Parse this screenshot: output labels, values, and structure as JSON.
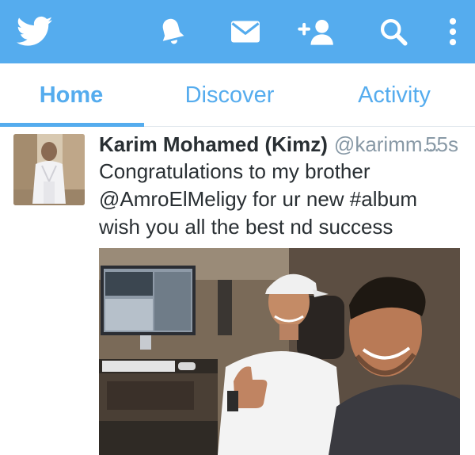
{
  "topbar": {
    "background": "#55acee",
    "icons": [
      "twitter-bird-icon",
      "bell-icon",
      "envelope-icon",
      "add-user-icon",
      "search-icon",
      "overflow-menu-icon"
    ]
  },
  "tabs": [
    {
      "label": "Home",
      "active": true
    },
    {
      "label": "Discover",
      "active": false
    },
    {
      "label": "Activity",
      "active": false
    }
  ],
  "tweet": {
    "name": "Karim Mohamed (Kimz)",
    "handle": "@karimm...",
    "time": "55s",
    "text_lines": [
      "Congratulations to my brother",
      "@AmroElMeligy for ur new #album",
      "wish you all the best nd success"
    ]
  },
  "colors": {
    "accent": "#55acee",
    "text": "#292f33",
    "muted": "#8899a6"
  }
}
